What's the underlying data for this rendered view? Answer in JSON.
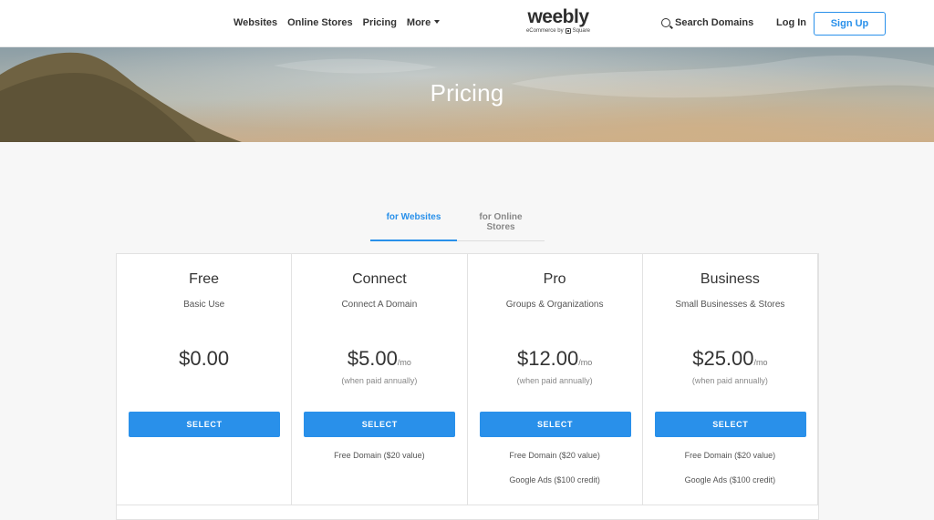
{
  "nav": {
    "websites": "Websites",
    "online_stores": "Online Stores",
    "pricing": "Pricing",
    "more": "More"
  },
  "logo": {
    "word": "weebly",
    "sub": "eCommerce by",
    "brand": "Square"
  },
  "header_actions": {
    "search": "Search Domains",
    "login": "Log In",
    "signup": "Sign Up"
  },
  "hero": {
    "title": "Pricing"
  },
  "tabs": [
    {
      "label": "for Websites",
      "active": true
    },
    {
      "label": "for Online Stores",
      "active": false
    }
  ],
  "plans": [
    {
      "name": "Free",
      "subtitle": "Basic Use",
      "price": "$0.00",
      "per": "",
      "note": "",
      "button": "SELECT",
      "features": [
        "",
        ""
      ]
    },
    {
      "name": "Connect",
      "subtitle": "Connect A Domain",
      "price": "$5.00",
      "per": "/mo",
      "note": "(when paid annually)",
      "button": "SELECT",
      "features": [
        "Free Domain ($20 value)",
        ""
      ]
    },
    {
      "name": "Pro",
      "subtitle": "Groups & Organizations",
      "price": "$12.00",
      "per": "/mo",
      "note": "(when paid annually)",
      "button": "SELECT",
      "features": [
        "Free Domain ($20 value)",
        "Google Ads ($100 credit)"
      ]
    },
    {
      "name": "Business",
      "subtitle": "Small Businesses & Stores",
      "price": "$25.00",
      "per": "/mo",
      "note": "(when paid annually)",
      "button": "SELECT",
      "features": [
        "Free Domain ($20 value)",
        "Google Ads ($100 credit)"
      ]
    }
  ],
  "colors": {
    "accent": "#2990ea",
    "text": "#333333",
    "background": "#f7f7f7"
  }
}
